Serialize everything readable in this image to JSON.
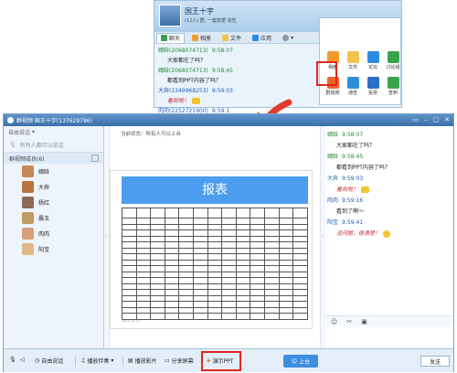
{
  "top_window": {
    "title": "国王十字",
    "subtitle": "(12人) 群, 一套数据 高性",
    "tabs": [
      "聊天",
      "相册",
      "文件",
      "应用"
    ],
    "messages": [
      {
        "user": "嫣晗(2068074713)",
        "time": "9:58:07",
        "color": "green"
      },
      {
        "text": "大家都在了吗？"
      },
      {
        "user": "嫣晗(2068074713)",
        "time": "9:58:45",
        "color": "green"
      },
      {
        "text": "都看到PPT内容了吗？"
      },
      {
        "user": "大奔(1349968253)",
        "time": "9:59:03",
        "color": "blue"
      },
      {
        "text": "看到啦！",
        "italic": true,
        "thumb": true
      },
      {
        "user": "肉肉(2252721900)",
        "time": "9:59:1",
        "color": "blue"
      }
    ],
    "apps": [
      {
        "label": "相册",
        "color": "#f39a2e"
      },
      {
        "label": "文件",
        "color": "#f2c34a"
      },
      {
        "label": "论坛",
        "color": "#2a8be2"
      },
      {
        "label": "讨论组",
        "color": "#3aa34a"
      },
      {
        "label": "群视频",
        "color": "#f0652a"
      },
      {
        "label": "通告",
        "color": "#2d8fd9"
      },
      {
        "label": "投票",
        "color": "#2a6fc8"
      },
      {
        "label": "签到",
        "color": "#3aa34a"
      }
    ]
  },
  "main_window": {
    "title": "群视频 国王十字(137629796)",
    "status": "自由说话",
    "all_in_label": "所有人都可以说话",
    "members_header": "群视频成员(6)",
    "members": [
      {
        "name": "嫣晗",
        "color": "#c68a5a"
      },
      {
        "name": "大奔",
        "color": "#b7763f"
      },
      {
        "name": "杨红",
        "color": "#8e6a55"
      },
      {
        "name": "晨玉",
        "color": "#c29a63"
      },
      {
        "name": "肉肉",
        "color": "#d7a07a"
      },
      {
        "name": "阳宝",
        "color": "#e0b98a"
      }
    ],
    "current_state": "当前状态：所有人可以上台",
    "slide": {
      "title": "报表",
      "footer": "2013.12.11"
    },
    "chat": [
      {
        "user": "嫣晗",
        "time": "9:58:07",
        "color": "green"
      },
      {
        "text": "大家都在了吗？"
      },
      {
        "user": "嫣晗",
        "time": "9:58:45",
        "color": "green"
      },
      {
        "text": "都看到PPT内容了吗？"
      },
      {
        "user": "大奔",
        "time": "9:59:03",
        "color": "blue"
      },
      {
        "text": "看到啦！",
        "italic": true,
        "thumb": true
      },
      {
        "user": "肉肉",
        "time": "9:59:16",
        "color": "blue"
      },
      {
        "text": "看到了啊～"
      },
      {
        "user": "阳宝",
        "time": "9:59:41",
        "color": "blue"
      },
      {
        "text": "没问题，很清楚！",
        "italic": true,
        "smile": true
      }
    ],
    "bottom_bar": {
      "free_talk": "自由说话",
      "music": "播放伴奏",
      "play_movie": "播放影片",
      "share_screen": "分享屏幕",
      "present_ppt": "演示PPT",
      "upload": "上台",
      "send": "发送"
    }
  }
}
